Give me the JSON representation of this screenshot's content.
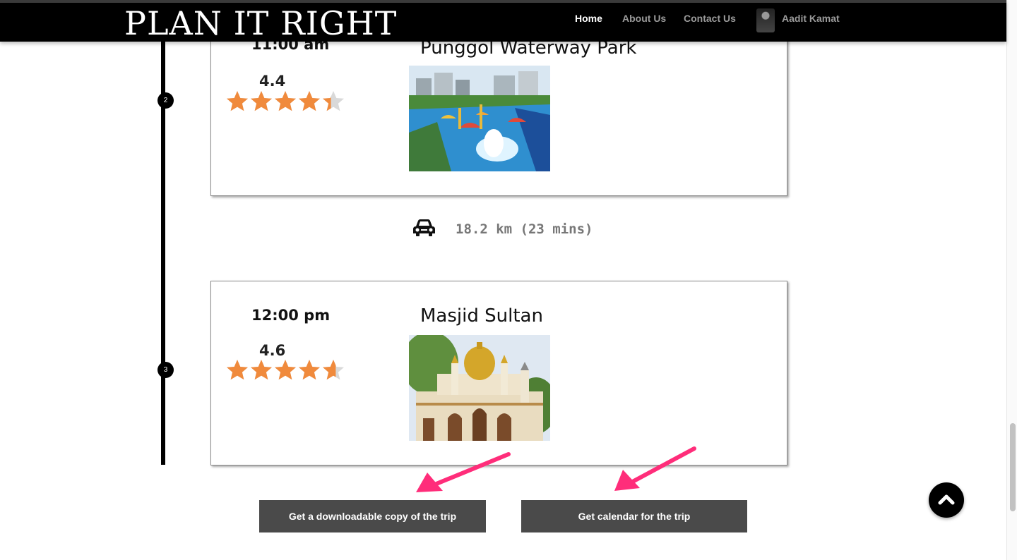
{
  "header": {
    "logo": "PLAN IT RIGHT",
    "nav": {
      "home": "Home",
      "about": "About Us",
      "contact": "Contact Us",
      "user": "Aadit Kamat"
    }
  },
  "itinerary": [
    {
      "stop_number": "2",
      "time": "11:00 am",
      "rating": "4.4",
      "place": "Punggol Waterway Park"
    },
    {
      "stop_number": "3",
      "time": "12:00 pm",
      "rating": "4.6",
      "place": "Masjid Sultan"
    }
  ],
  "travel": {
    "icon": "car-icon",
    "text": "18.2 km (23 mins)"
  },
  "actions": {
    "download_label": "Get a downloadable copy of the trip",
    "calendar_label": "Get calendar for the trip"
  },
  "colors": {
    "star": "#f08a3c",
    "star_empty": "#d9d9d9",
    "annotation_arrow": "#ff2d7a",
    "button_bg": "#4a4a4a",
    "header_bg": "#000000"
  },
  "ratings_display": {
    "stop_2_stars": 4.4,
    "stop_3_stars": 4.6,
    "max_stars": 5
  }
}
